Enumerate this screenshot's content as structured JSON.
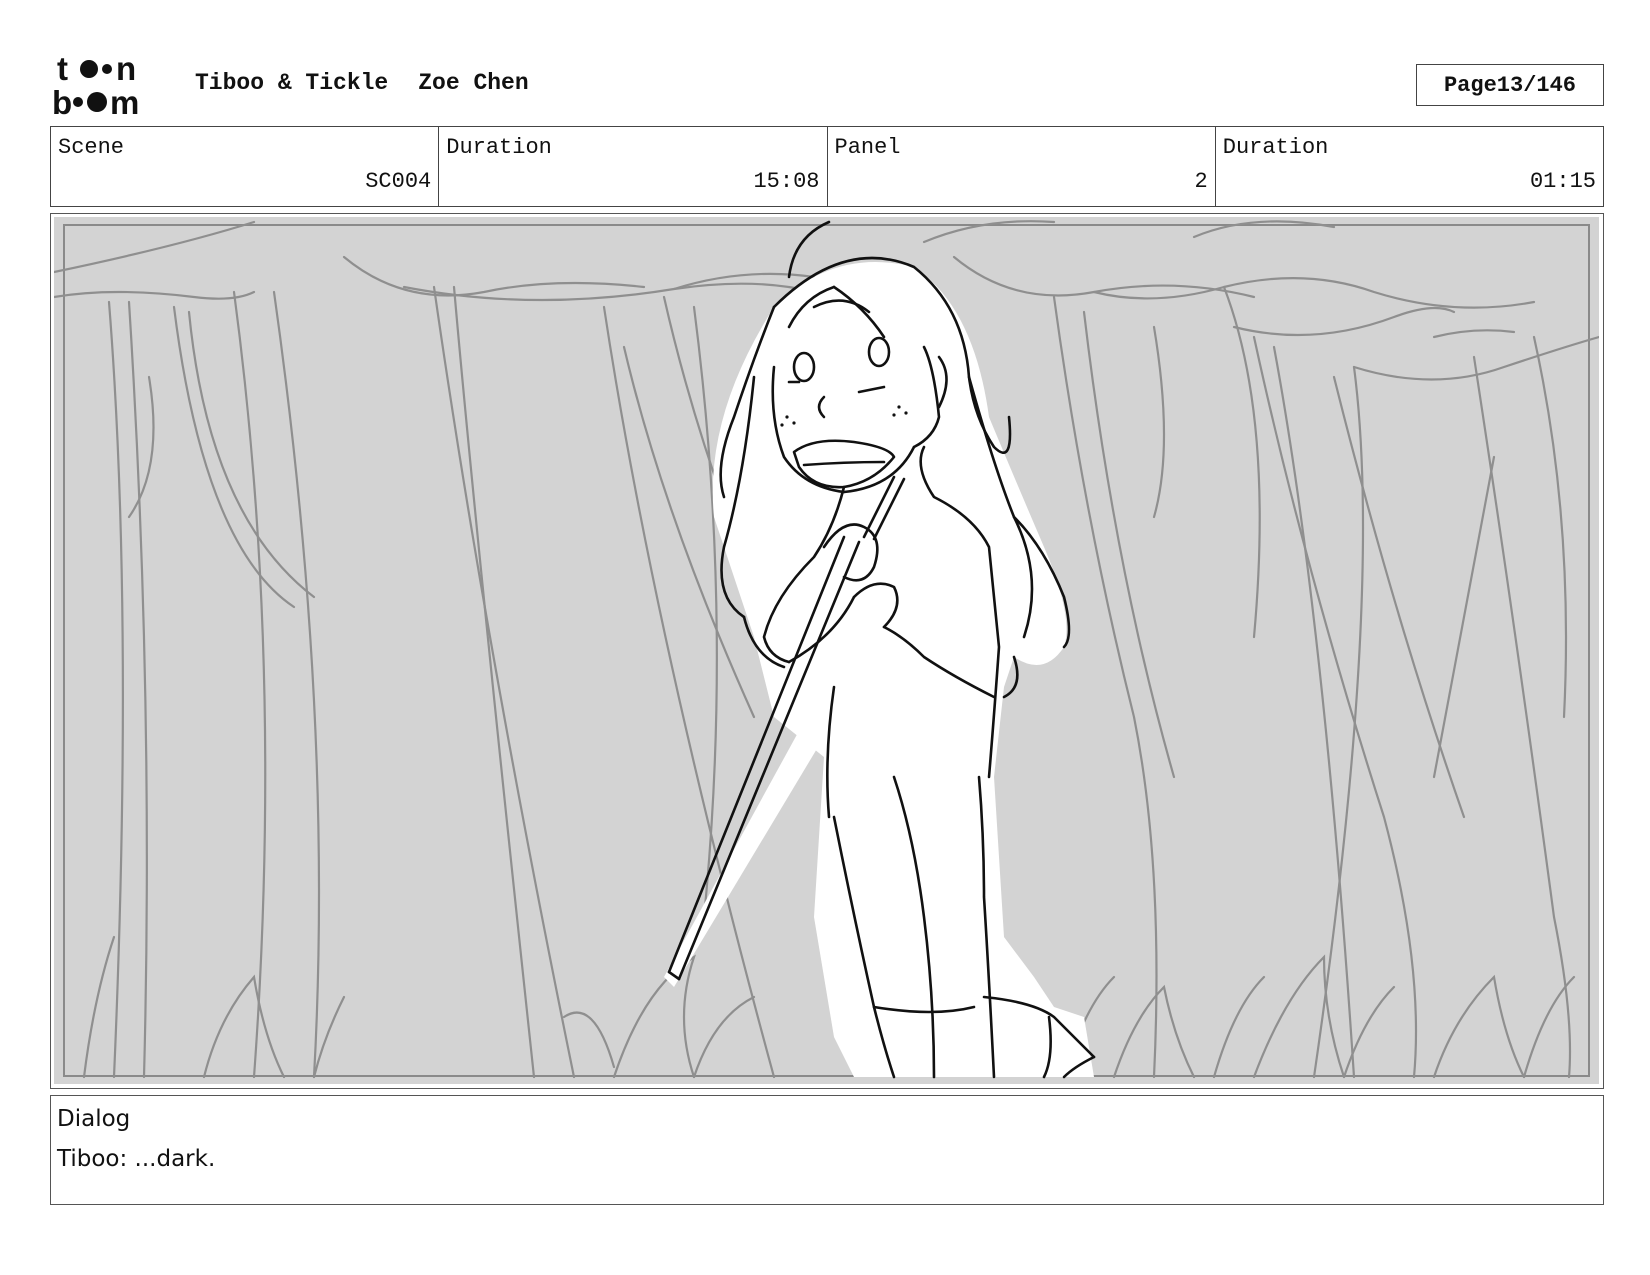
{
  "header": {
    "project": "Tiboo & Tickle",
    "artist": "Zoe Chen",
    "page_label": "Page",
    "page_number": "13/146"
  },
  "logo": {
    "icon": "toon-boom-logo",
    "text": "toon boom"
  },
  "info": {
    "scene_label": "Scene",
    "scene_value": "SC004",
    "scene_duration_label": "Duration",
    "scene_duration_value": "15:08",
    "panel_label": "Panel",
    "panel_value": "2",
    "panel_duration_label": "Duration",
    "panel_duration_value": "01:15"
  },
  "panel": {
    "image": "storyboard-sketch-girl-holding-stick-in-forest"
  },
  "dialog": {
    "label": "Dialog",
    "text": "Tiboo: ...dark."
  },
  "colors": {
    "panel_background": "#d3d3d3",
    "sketch_line": "#8a8a8a",
    "character_line": "#111111",
    "border": "#444444"
  }
}
